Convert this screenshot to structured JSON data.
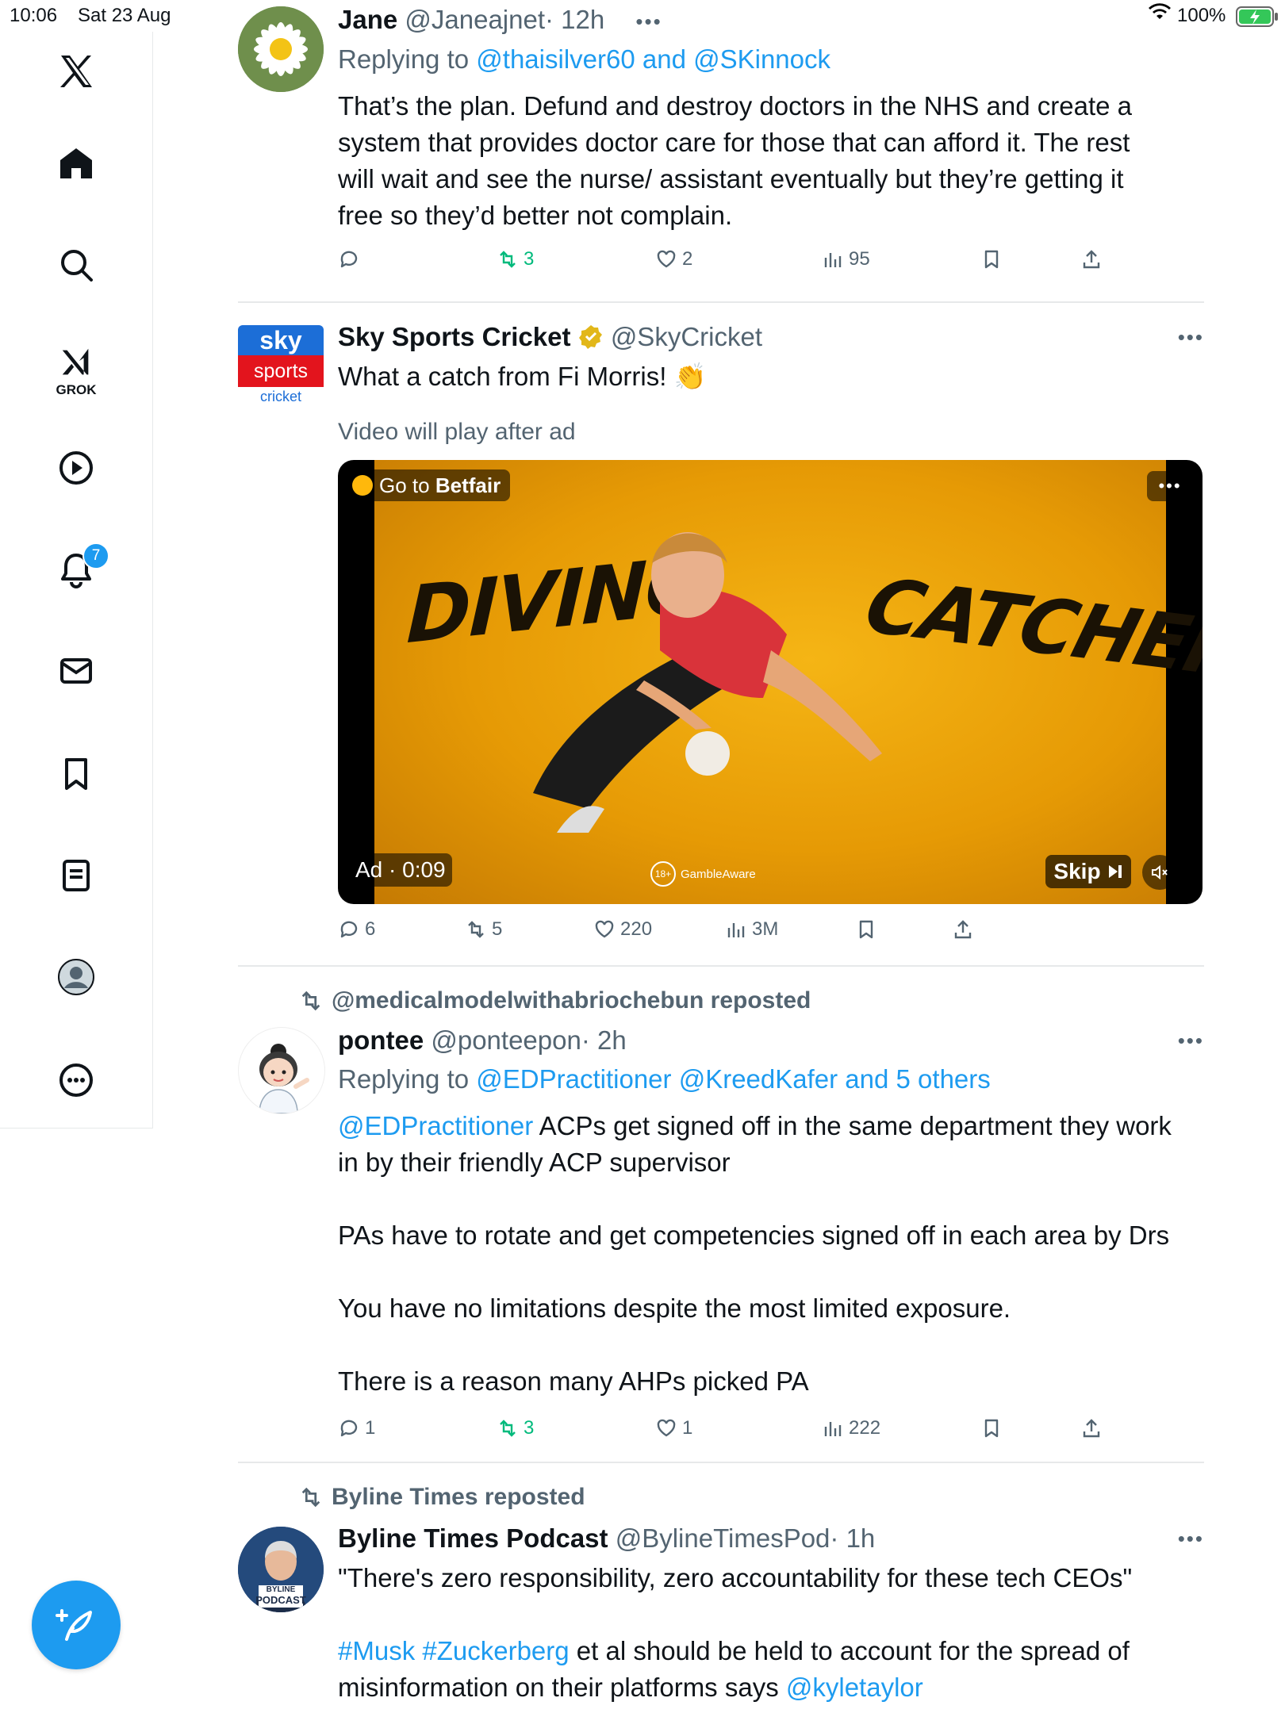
{
  "status_bar": {
    "time": "10:06",
    "date": "Sat 23 Aug",
    "battery": "100%"
  },
  "sidebar": {
    "items": [
      {
        "name": "X"
      },
      {
        "name": "Home"
      },
      {
        "name": "Search"
      },
      {
        "name": "Grok",
        "label": "GROK"
      },
      {
        "name": "Videos"
      },
      {
        "name": "Notifications"
      },
      {
        "name": "Messages"
      },
      {
        "name": "Bookmarks"
      },
      {
        "name": "Lists"
      },
      {
        "name": "Profile"
      },
      {
        "name": "More"
      }
    ],
    "notification_count": "7"
  },
  "tweets": [
    {
      "display_name": "Jane",
      "handle": "@Janeajnet",
      "time": "· 12h",
      "reply_prefix": "Replying to",
      "reply_targets": "@thaisilver60 and @SKinnock",
      "text_lines": [
        "That’s the plan. Defund and destroy doctors in the NHS and create a",
        "system that provides doctor care for those that can afford it. The rest",
        "will wait and see the nurse/ assistant eventually but they’re getting it",
        "free so they’d better not complain."
      ],
      "replies": "",
      "reposts": "3",
      "likes": "2",
      "views": "95"
    },
    {
      "display_name": "Sky Sports Cricket",
      "handle": "@SkyCricket",
      "text": "What a catch from Fi Morris! 👏",
      "video_notice": "Video will play after ad",
      "avatar_text": {
        "line1": "sky",
        "line2": "sports",
        "line3": "cricket"
      },
      "video": {
        "cta_prefix": "Go to ",
        "cta_brand": "Betfair",
        "word1": "DIVING",
        "word2": "CATCHERS",
        "ad_timer": "Ad · 0:09",
        "gamble_badge": "18+",
        "gamble_text": "GambleAware",
        "skip": "Skip"
      },
      "replies": "6",
      "reposts": "5",
      "likes": "220",
      "views": "3M"
    },
    {
      "reposted_by": "@medicalmodelwithabriochebun reposted",
      "display_name": "pontee",
      "handle": "@ponteepon",
      "time": "· 2h",
      "reply_prefix": "Replying to",
      "reply_targets": "@EDPractitioner @KreedKafer and 5 others",
      "mention": "@EDPractitioner",
      "text_line1": " ACPs get signed off in the same department they work",
      "text_line2": "in by their friendly ACP supervisor",
      "para2": "PAs have to rotate and get competencies signed off in each area by Drs",
      "para3": "You have no limitations despite the most limited exposure.",
      "para4": "There is a reason many AHPs picked PA",
      "replies": "1",
      "reposts": "3",
      "likes": "1",
      "views": "222"
    },
    {
      "reposted_by": "Byline Times reposted",
      "display_name": "Byline Times Podcast",
      "handle": "@BylineTimesPod",
      "time": "· 1h",
      "quote": "\"There's zero responsibility, zero accountability for these tech CEOs\"",
      "hashtags": "#Musk #Zuckerberg",
      "line2_rest": " et al should be held to account for the spread of",
      "line3_prefix": "misinformation on their platforms says ",
      "line3_mention": "@kyletaylor",
      "avatar_text": {
        "line1": "BYLINE",
        "line2": "PODCAST"
      }
    }
  ],
  "colors": {
    "accent": "#1d9bf0",
    "repost_green": "#00ba7c",
    "muted": "#536471",
    "verified": "#e2b719"
  }
}
